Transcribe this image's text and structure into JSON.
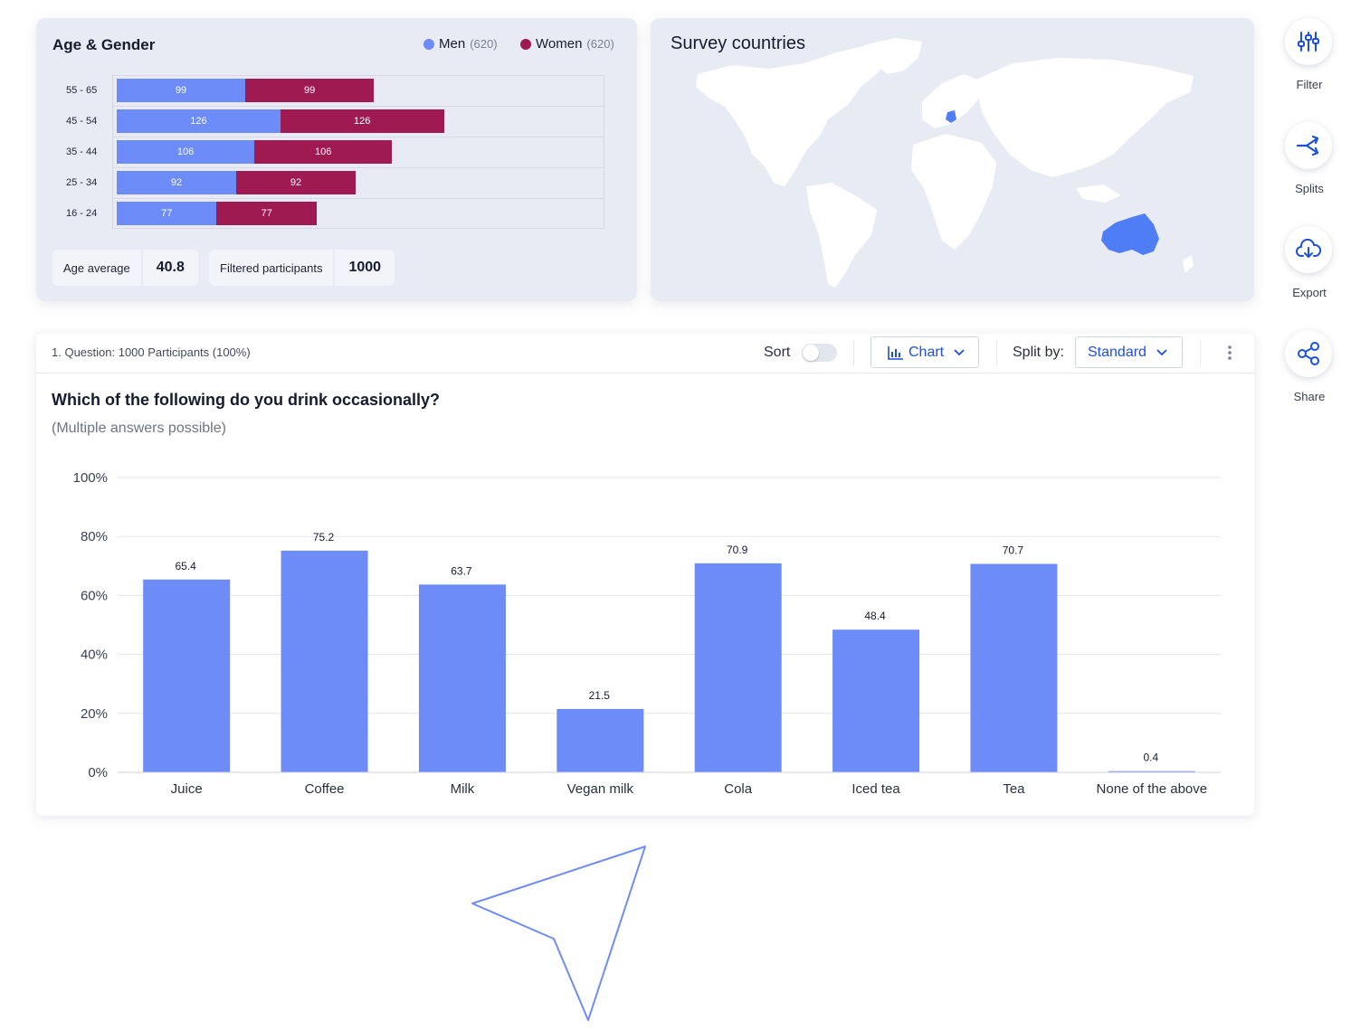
{
  "age_gender": {
    "title": "Age & Gender",
    "legend": [
      {
        "name": "Men",
        "count": "(620)",
        "color": "#6e8cf7"
      },
      {
        "name": "Women",
        "count": "(620)",
        "color": "#a01a52"
      }
    ],
    "rows": [
      {
        "label": "55 - 65",
        "men": 99,
        "women": 99
      },
      {
        "label": "45 - 54",
        "men": 126,
        "women": 126
      },
      {
        "label": "35 - 44",
        "men": 106,
        "women": 106
      },
      {
        "label": "25 - 34",
        "men": 92,
        "women": 92
      },
      {
        "label": "16 - 24",
        "men": 77,
        "women": 77
      }
    ],
    "stats": {
      "age_average_label": "Age average",
      "age_average_value": "40.8",
      "filtered_label": "Filtered participants",
      "filtered_value": "1000"
    }
  },
  "map": {
    "title": "Survey countries",
    "highlighted_countries_color": "#4f7df5"
  },
  "question": {
    "meta": "1. Question: 1000 Participants (100%)",
    "sort_label": "Sort",
    "sort_enabled": false,
    "chart_button_label": "Chart",
    "split_by_label": "Split by:",
    "split_value": "Standard",
    "title": "Which of the following do you drink occasionally?",
    "subtitle": "(Multiple answers possible)"
  },
  "chart_data": {
    "type": "bar",
    "categories": [
      "Juice",
      "Coffee",
      "Milk",
      "Vegan milk",
      "Cola",
      "Iced tea",
      "Tea",
      "None of the above"
    ],
    "values": [
      65.4,
      75.2,
      63.7,
      21.5,
      70.9,
      48.4,
      70.7,
      0.4
    ],
    "value_labels": [
      "65.4",
      "75.2",
      "63.7",
      "21.5",
      "70.9",
      "48.4",
      "70.7",
      "0.4"
    ],
    "yticks": [
      "0%",
      "20%",
      "40%",
      "60%",
      "80%",
      "100%"
    ],
    "ylim": [
      0,
      100
    ],
    "grid": true,
    "color": "#6e8cf7"
  },
  "sidebar": {
    "buttons": [
      {
        "label": "Filter",
        "icon": "sliders-icon"
      },
      {
        "label": "Splits",
        "icon": "split-arrow-icon"
      },
      {
        "label": "Export",
        "icon": "cloud-download-icon"
      },
      {
        "label": "Share",
        "icon": "share-icon"
      }
    ]
  },
  "colors": {
    "accent": "#1c4fe0",
    "men": "#6e8cf7",
    "women": "#a01a52",
    "card_bg": "#e8ebf4"
  }
}
